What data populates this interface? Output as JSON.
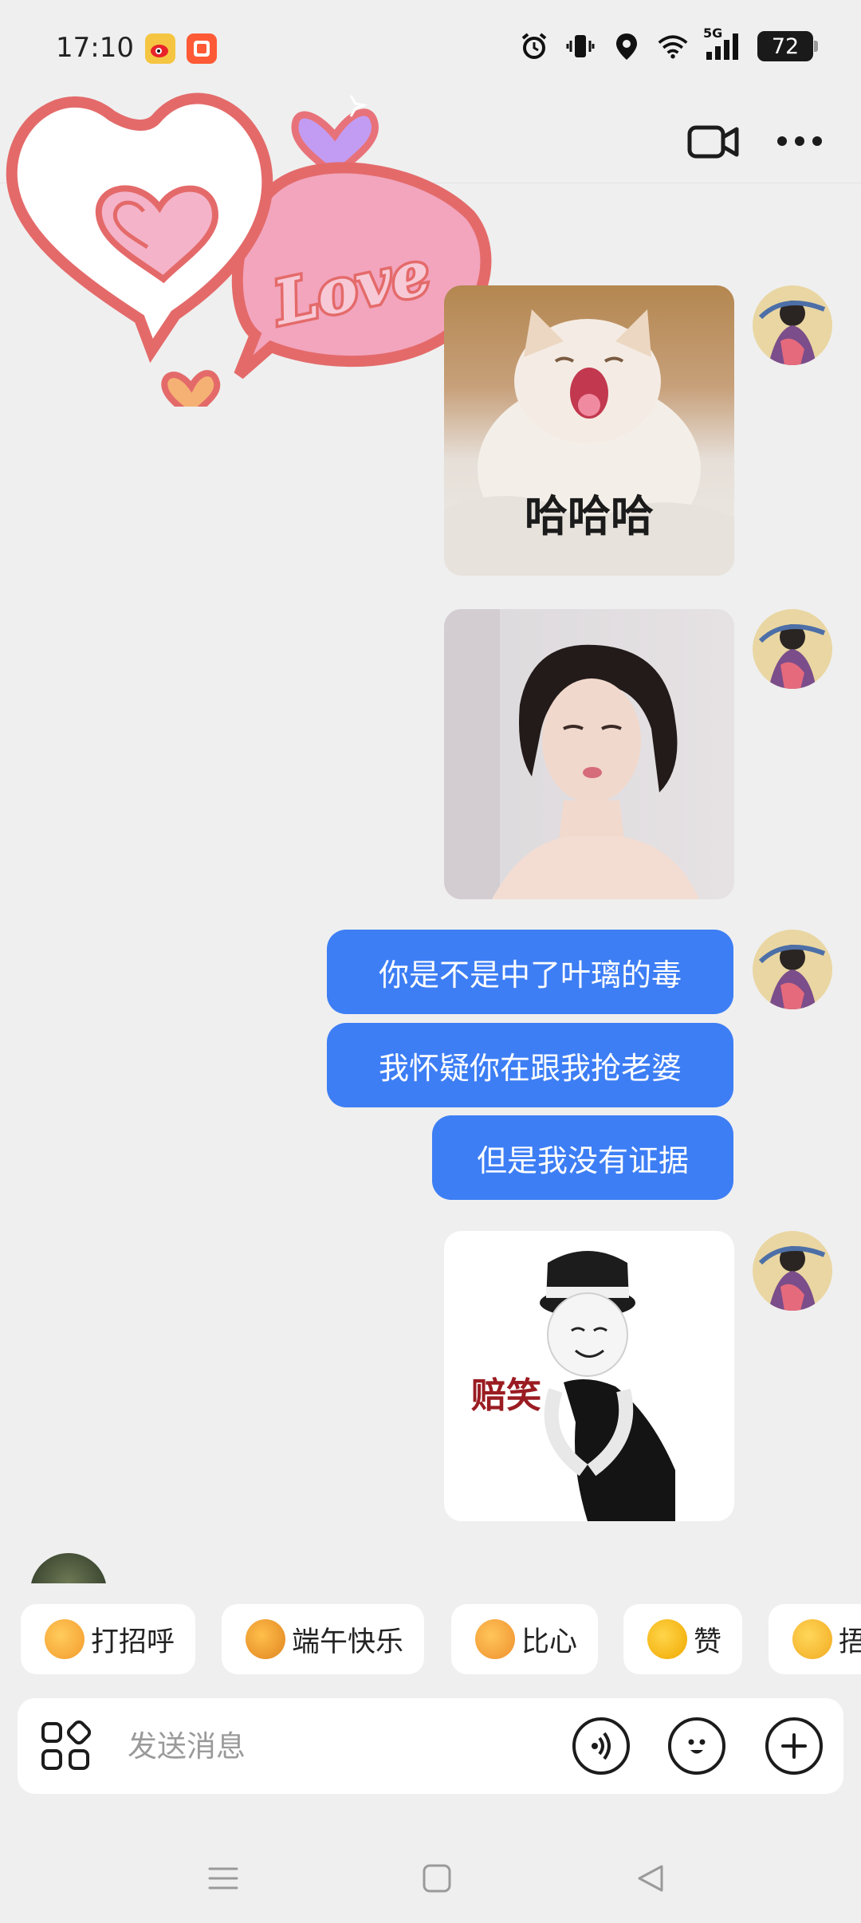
{
  "status_bar": {
    "time": "17:10",
    "network": "5G",
    "battery": "72"
  },
  "header": {
    "video_icon": "video-camera-icon",
    "more_icon": "more-dots-icon"
  },
  "decoration": {
    "love_sticker_text": "Love"
  },
  "messages": [
    {
      "type": "sticker",
      "caption": "哈哈哈"
    },
    {
      "type": "photo"
    },
    {
      "type": "text",
      "text": "你是不是中了叶璃的毒"
    },
    {
      "type": "text",
      "text": "我怀疑你在跟我抢老婆"
    },
    {
      "type": "text",
      "text": "但是我没有证据"
    },
    {
      "type": "sticker",
      "caption": "赔笑"
    }
  ],
  "quick_replies": [
    {
      "label": "打招呼",
      "color": "#f7a53a"
    },
    {
      "label": "端午快乐",
      "color": "#f0a030"
    },
    {
      "label": "比心",
      "color": "#f2a23a"
    },
    {
      "label": "赞",
      "color": "#f5b800"
    },
    {
      "label": "捂",
      "color": "#f7c02e"
    }
  ],
  "input": {
    "placeholder": "发送消息"
  },
  "colors": {
    "bubble": "#3d7ef5",
    "background": "#efefef"
  }
}
